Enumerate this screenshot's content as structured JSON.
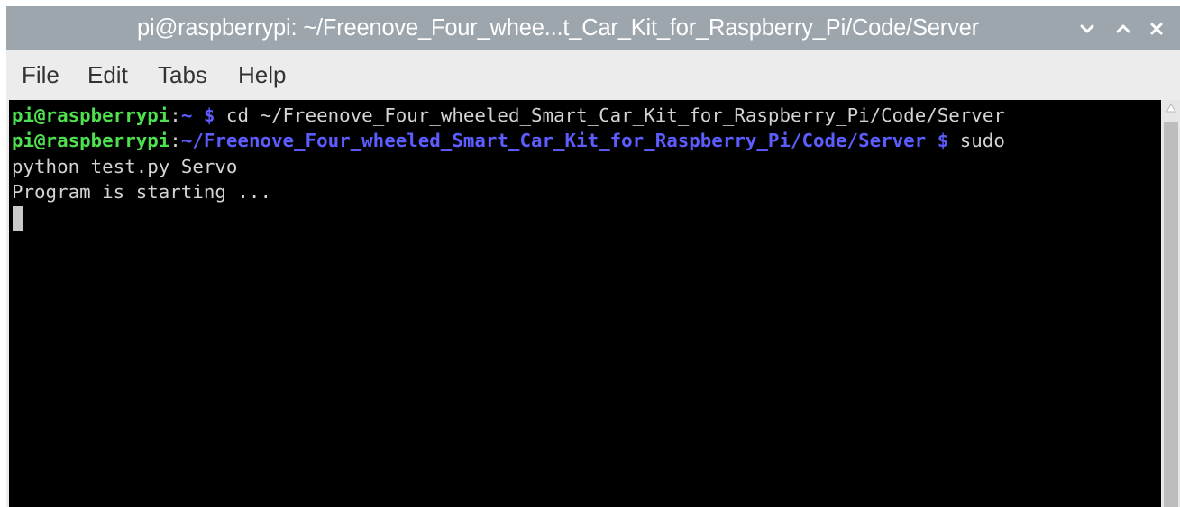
{
  "window": {
    "title": "pi@raspberrypi: ~/Freenove_Four_whee...t_Car_Kit_for_Raspberry_Pi/Code/Server"
  },
  "titlebar_buttons": {
    "minimize_icon": "chevron-down-icon",
    "maximize_icon": "chevron-up-icon",
    "close_icon": "close-icon"
  },
  "menu": {
    "items": [
      "File",
      "Edit",
      "Tabs",
      "Help"
    ]
  },
  "terminal": {
    "lines": [
      {
        "user": "pi@raspberrypi",
        "sep": ":",
        "path": "~",
        "prompt": " $",
        "cmd": " cd ~/Freenove_Four_wheeled_Smart_Car_Kit_for_Raspberry_Pi/Code/Server"
      },
      {
        "user": "pi@raspberrypi",
        "sep": ":",
        "path": "~/Freenove_Four_wheeled_Smart_Car_Kit_for_Raspberry_Pi/Code/Server",
        "prompt": " $",
        "cmd": " sudo"
      },
      {
        "text": "python test.py Servo"
      },
      {
        "text": "Program is starting ..."
      }
    ]
  },
  "colors": {
    "titlebar": "#9da5ad",
    "prompt_user": "#4ee04e",
    "prompt_path": "#5c5cff",
    "terminal_bg": "#000000",
    "terminal_text": "#d3d3d3"
  }
}
